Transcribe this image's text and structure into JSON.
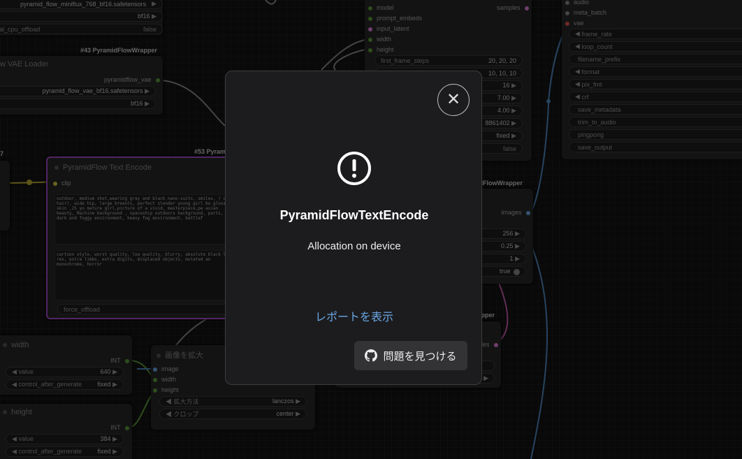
{
  "top_left_node": {
    "rows": [
      {
        "value": "pyramid_flow_miniflux_768_bf16.safetensors"
      },
      {
        "value": "bf16"
      },
      {
        "label": "al_cpu_offload",
        "value": "false"
      }
    ]
  },
  "vae_node": {
    "header": "#43 PyramidFlowWrapper",
    "title": "w VAE Loader",
    "output": "pyramidflow_vae",
    "rows": [
      {
        "value": "pyramid_flow_vae_bf16.safetensors"
      },
      {
        "value": "bf16"
      }
    ]
  },
  "left_edge_node": {
    "header": "7"
  },
  "text_encode_node": {
    "header": "#53 Pyram",
    "title": "PyramidFlow Text Encode",
    "input": "clip",
    "positive_prompt": "outdoor, medium shot,wearing gray and black nano-suits, smiles, ( cyt hair), wide hip, large breasts, perfect slender young girl bo glossy skin ,25 yo mature girl,picture of a vivid, masterpiece,pe asian beauty, Machine background , spaceship outdoors background, parts, dark and foggy environment, heavy fog environment, battlef",
    "negative_prompt": "cartoon style, worst quality, low quality, blurry, absolute black low res, extra limbs, extra digits, misplaced objects, mutated an monochrome, horror",
    "force_offload": "force_offload"
  },
  "sampler_node": {
    "inputs": [
      "model",
      "prompt_embeds",
      "input_latent",
      "width",
      "height"
    ],
    "output": "samples",
    "rows": [
      {
        "label": "first_frame_steps",
        "value": "20, 20, 20"
      },
      {
        "label": "",
        "value": "10, 10, 10"
      },
      {
        "label": "",
        "value": "16"
      },
      {
        "label": "",
        "value": "7.00"
      },
      {
        "label": "",
        "value": "4.00"
      },
      {
        "label": "",
        "value": "8861402"
      },
      {
        "label": "",
        "value": "fixed"
      },
      {
        "label": "",
        "value": "false"
      }
    ]
  },
  "video_combine_node": {
    "inputs": [
      "audio",
      "meta_batch",
      "vae"
    ],
    "rows": [
      "frame_rate",
      "loop_count",
      "filename_prefix",
      "format",
      "pix_fmt",
      "crf",
      "save_metadata",
      "trim_to_audio",
      "pingpong",
      "save_output"
    ]
  },
  "decode_node": {
    "header": "idFlowWrapper",
    "output": "images",
    "rows": [
      "256",
      "0.25",
      "1",
      "true"
    ]
  },
  "lower_right_node": {
    "header": "rapper",
    "output": "amples"
  },
  "width_node": {
    "title": "width",
    "output": "INT",
    "rows": [
      {
        "label": "value",
        "value": "640"
      },
      {
        "label": "control_after_generate",
        "value": "fixed"
      }
    ]
  },
  "height_node": {
    "title": "height",
    "output": "INT",
    "rows": [
      {
        "label": "value",
        "value": "384"
      },
      {
        "label": "control_after_generate",
        "value": "fixed"
      }
    ]
  },
  "upscale_node": {
    "title": "画像を拡大",
    "inputs": [
      "image",
      "width",
      "height"
    ],
    "rows": [
      {
        "label": "拡大方法",
        "value": "lanczos"
      },
      {
        "label": "クロップ",
        "value": "center"
      }
    ]
  },
  "dialog": {
    "title": "PyramidFlowTextEncode",
    "message": "Allocation on device",
    "report_link": "レポートを表示",
    "find_issue_button": "問題を見つける",
    "close_icon": "close-icon",
    "error_icon": "exclamation-circle-icon",
    "github_icon": "github-icon"
  },
  "colors": {
    "link": "#6aa7e6",
    "selected_border": "#a54ccb",
    "int_slot": "#5c9b3a",
    "clip_slot": "#d4c642",
    "image_slot": "#6aa7e6",
    "latent_slot": "#e07dd8",
    "vae_slot": "#e05050"
  }
}
